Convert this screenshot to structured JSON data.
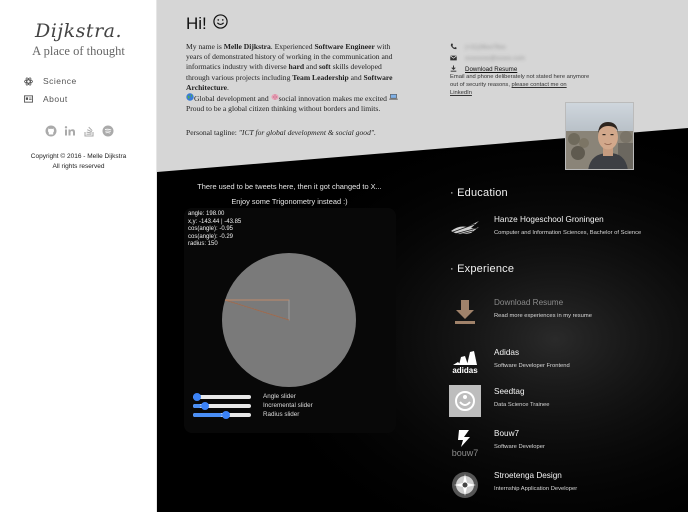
{
  "sidebar": {
    "brand": "Dijkstra.",
    "tagline": "A place of thought",
    "nav": [
      {
        "label": "Science",
        "icon": "atom-icon"
      },
      {
        "label": "About",
        "icon": "id-card-icon"
      }
    ],
    "social": [
      "github-icon",
      "linkedin-icon",
      "stackoverflow-icon",
      "spotify-icon"
    ],
    "copyright_line1": "Copyright © 2016 - Melle Dijkstra",
    "copyright_line2": "All rights reserved"
  },
  "intro": {
    "greeting": "Hi!",
    "bio_1": "My name is ",
    "bio_name": "Melle Dijkstra",
    "bio_2": ". Experienced ",
    "bio_role": "Software Engineer",
    "bio_3": " with years of demonstrated history of working in the communication and informatics industry with diverse ",
    "bio_hard": "hard",
    "bio_4": " and ",
    "bio_soft": "soft",
    "bio_5": " skills developed through various projects including ",
    "bio_lead": "Team Leadership",
    "bio_6": " and ",
    "bio_arch": "Software Architecture",
    "bio_7": ".",
    "bio_8": "Global development and ",
    "bio_9": "social innovation makes me excited ",
    "bio_10": " Proud to be a global citizen thinking without borders and limits.",
    "tagline_label": "Personal tagline: ",
    "tagline_value": "\"ICT for global development & social good\"."
  },
  "contact": {
    "phone": "(+31)06xx78xx",
    "email": "xxxxxxxx@xxxxx.com",
    "download_label": "Download Resume",
    "note_1": "Email and phone deliberately not stated here anymore out of security reasons, ",
    "note_link": "please contact me on LinkedIn"
  },
  "trig": {
    "tweet_note_1": "There used to be tweets here, then it got changed to X...",
    "tweet_note_2": "Enjoy some Trigonometry instead :)",
    "angle": "angle: 198.00",
    "xy": "x,y: -143.44 | -43.85",
    "cos": "cos(angle): -0.95",
    "sin": "cos(angle): -0.29",
    "radius": "radius: 150",
    "sliders": [
      {
        "label": "Angle slider",
        "value": 0.0
      },
      {
        "label": "Incremental slider",
        "value": 0.14
      },
      {
        "label": "Radius slider",
        "value": 0.5
      }
    ]
  },
  "education": {
    "title": "Education",
    "items": [
      {
        "title": "Hanze Hogeschool Groningen",
        "sub": "Computer and Information Sciences, Bachelor of Science"
      }
    ]
  },
  "experience": {
    "title": "Experience",
    "items": [
      {
        "title": "Download Resume",
        "sub": "Read more experiences in my resume",
        "logo": "download-icon"
      },
      {
        "title": "Adidas",
        "sub": "Software Developer Frontend",
        "logo": "adidas-logo"
      },
      {
        "title": "Seedtag",
        "sub": "Data Science Trainee",
        "logo": "seedtag-logo"
      },
      {
        "title": "Bouw7",
        "sub": "Software Developer",
        "logo": "bouw7-logo",
        "logo_text": "bouw7"
      },
      {
        "title": "Stroetenga Design",
        "sub": "Internship Application Developer",
        "logo": "stroetenga-logo"
      }
    ]
  },
  "colors": {
    "accent": "#3b82f6",
    "dark": "#000000",
    "light_section": "#d6d6d6"
  }
}
